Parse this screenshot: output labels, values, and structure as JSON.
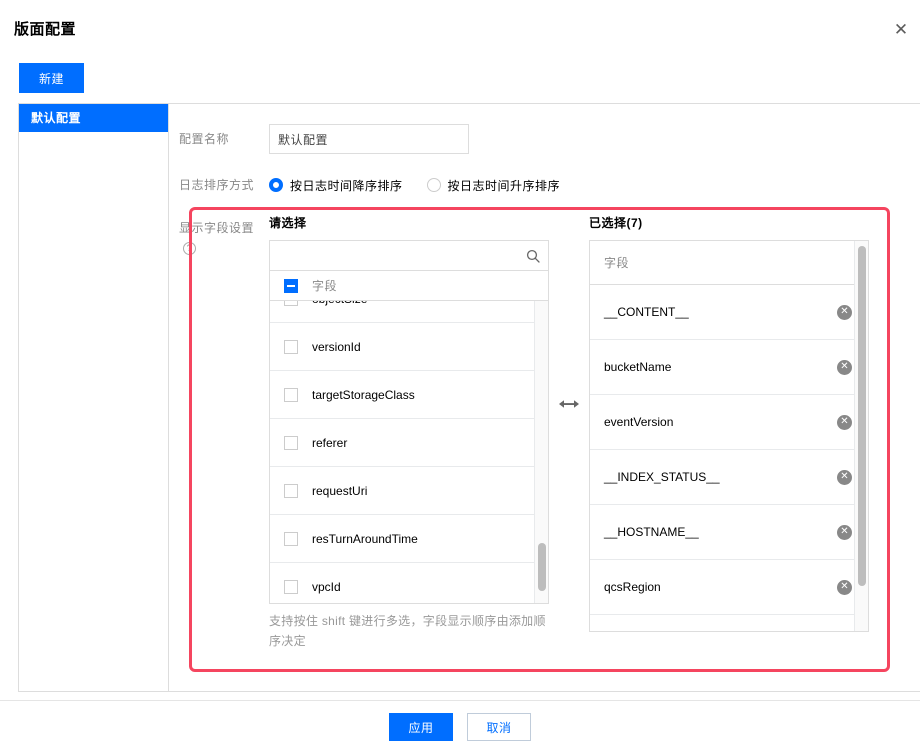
{
  "dialog": {
    "title": "版面配置",
    "close_icon": "close-icon"
  },
  "toolbar": {
    "new_label": "新建"
  },
  "sidebar": {
    "items": [
      {
        "label": "默认配置",
        "active": true
      }
    ]
  },
  "form": {
    "name_label": "配置名称",
    "name_value": "默认配置",
    "name_placeholder": "",
    "sort_label": "日志排序方式",
    "sort_options": [
      {
        "label": "按日志时间降序排序",
        "checked": true
      },
      {
        "label": "按日志时间升序排序",
        "checked": false
      }
    ],
    "fields_label": "显示字段设置",
    "fields_help_icon": "help-icon"
  },
  "transfer": {
    "source_title": "请选择",
    "search_value": "",
    "search_placeholder": "",
    "search_icon": "search-icon",
    "group_label": "字段",
    "group_checkbox_state": "indeterminate",
    "source_items": [
      {
        "label": "objectSize",
        "checked": false
      },
      {
        "label": "versionId",
        "checked": false
      },
      {
        "label": "targetStorageClass",
        "checked": false
      },
      {
        "label": "referer",
        "checked": false
      },
      {
        "label": "requestUri",
        "checked": false
      },
      {
        "label": "resTurnAroundTime",
        "checked": false
      },
      {
        "label": "vpcId",
        "checked": false
      }
    ],
    "arrows_icon": "transfer-arrows-icon",
    "target_title": "已选择(7)",
    "target_column_header": "字段",
    "target_items": [
      {
        "label": "__CONTENT__"
      },
      {
        "label": "bucketName"
      },
      {
        "label": "eventVersion"
      },
      {
        "label": "__INDEX_STATUS__"
      },
      {
        "label": "__HOSTNAME__"
      },
      {
        "label": "qcsRegion"
      }
    ],
    "remove_icon": "remove-icon",
    "hint": "支持按住 shift 键进行多选，字段显示顺序由添加顺序决定"
  },
  "footer": {
    "apply_label": "应用",
    "cancel_label": "取消"
  },
  "colors": {
    "accent": "#006eff",
    "annotation": "#f5455f",
    "border": "#dddddd",
    "muted_text": "#888888"
  }
}
